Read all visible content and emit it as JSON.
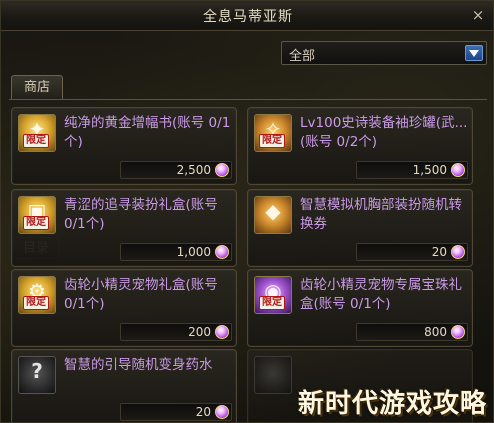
{
  "window": {
    "title": "全息马蒂亚斯",
    "close_label": "×"
  },
  "filter": {
    "value": "全部"
  },
  "tabs": {
    "shop": "商店",
    "catalog": "目录"
  },
  "items": [
    {
      "name": "纯净的黄金增幅书(账号 0/1个)",
      "price": "2,500",
      "badge": "限定",
      "icon": "gold-book-icon"
    },
    {
      "name": "Lv100史诗装备袖珍罐(武...(账号 0/2个)",
      "price": "1,500",
      "badge": "限定",
      "icon": "epic-jar-icon"
    },
    {
      "name": "青涩的追寻装扮礼盒(账号 0/1个)",
      "price": "1,000",
      "badge": "限定",
      "icon": "gift-box-icon"
    },
    {
      "name": "智慧模拟机胸部装扮随机转换券",
      "price": "20",
      "badge": "",
      "icon": "ticket-icon"
    },
    {
      "name": "齿轮小精灵宠物礼盒(账号 0/1个)",
      "price": "200",
      "badge": "限定",
      "icon": "pet-box-icon"
    },
    {
      "name": "齿轮小精灵宠物专属宝珠礼盒(账号 0/1个)",
      "price": "800",
      "badge": "限定",
      "icon": "orb-box-icon"
    },
    {
      "name": "智慧的引导随机变身药水",
      "price": "20",
      "badge": "",
      "icon": "mystery-potion-icon"
    }
  ],
  "watermark": "新时代游戏攻略",
  "colors": {
    "item_name": "#c99ae6",
    "badge_red": "#b01818",
    "dropdown_blue": "#2f5fa8"
  }
}
